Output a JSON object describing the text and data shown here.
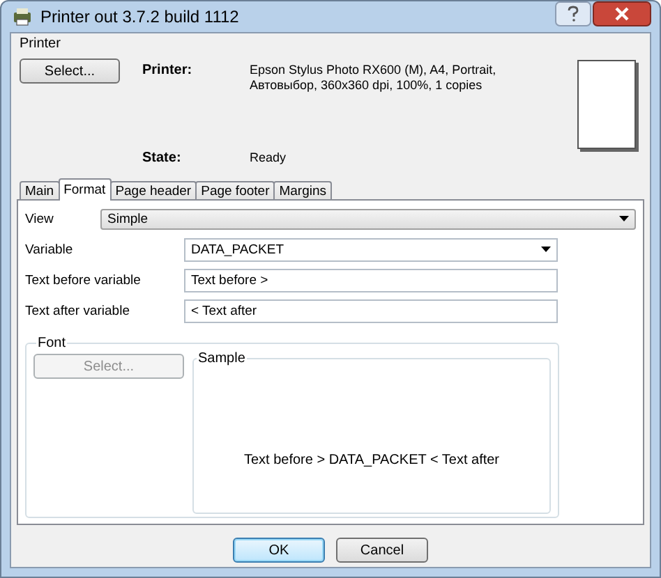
{
  "window": {
    "title": "Printer out 3.7.2 build 1112"
  },
  "printer_group": {
    "title": "Printer",
    "select_button": "Select...",
    "printer_label": "Printer:",
    "printer_value": "Epson Stylus Photo RX600 (M), A4, Portrait, Автовыбор, 360x360 dpi, 100%, 1 copies",
    "state_label": "State:",
    "state_value": "Ready"
  },
  "tabs": [
    {
      "label": "Main",
      "selected": false
    },
    {
      "label": "Format",
      "selected": true
    },
    {
      "label": "Page header",
      "selected": false
    },
    {
      "label": "Page footer",
      "selected": false
    },
    {
      "label": "Margins",
      "selected": false
    }
  ],
  "form": {
    "view_label": "View",
    "view_value": "Simple",
    "variable_label": "Variable",
    "variable_value": "DATA_PACKET",
    "before_label": "Text before variable",
    "before_value": "Text before >",
    "after_label": "Text after variable",
    "after_value": "< Text after"
  },
  "font_group": {
    "title": "Font",
    "select_button": {
      "label": "Select...",
      "disabled": true
    }
  },
  "sample_group": {
    "title": "Sample",
    "text": "Text before > DATA_PACKET < Text after"
  },
  "buttons": [
    {
      "label": "OK",
      "default": true
    },
    {
      "label": "Cancel",
      "default": false
    }
  ]
}
